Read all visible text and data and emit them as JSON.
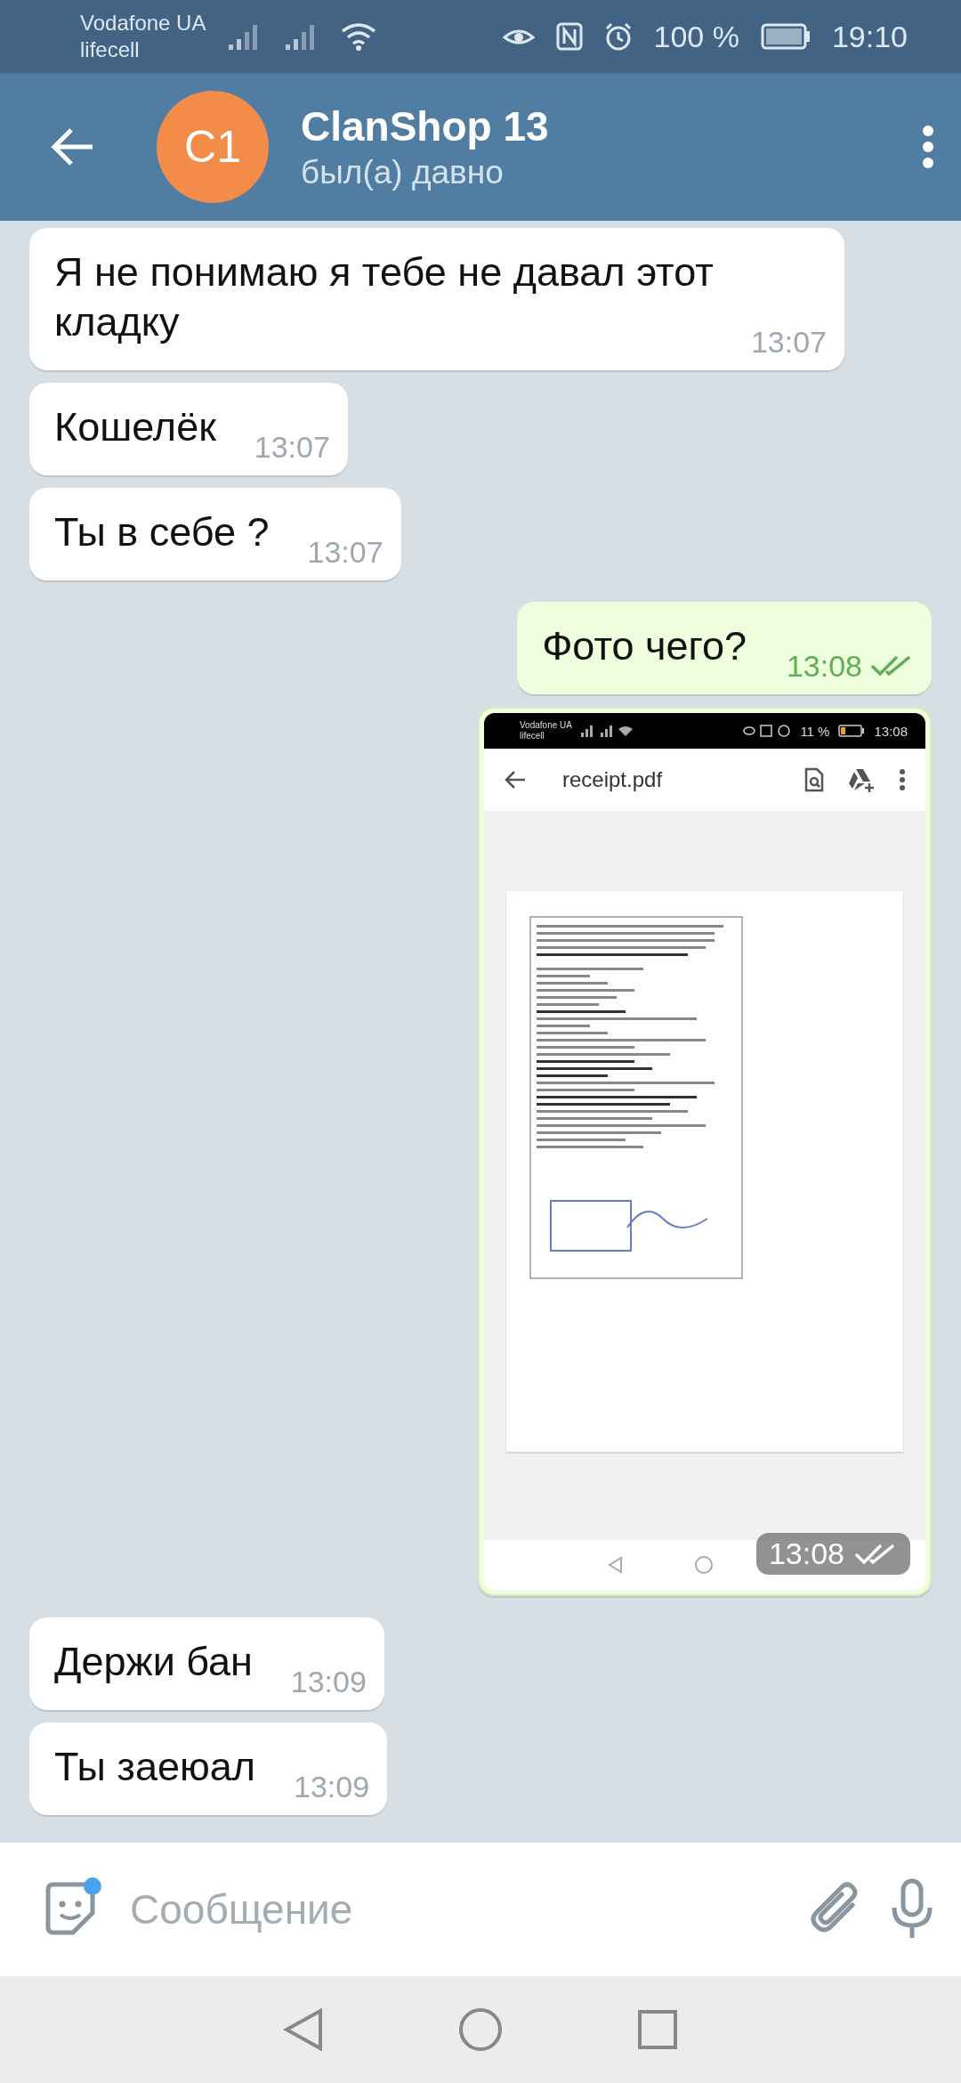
{
  "status_bar": {
    "carrier_1": "Vodafone UA",
    "carrier_2": "lifecell",
    "battery": "100 %",
    "time": "19:10"
  },
  "header": {
    "avatar_initials": "C1",
    "title": "ClanShop 13",
    "subtitle": "был(а) давно"
  },
  "messages": [
    {
      "kind": "text",
      "outgoing": false,
      "text": "Я не понимаю я тебе не давал этот кладку",
      "time": "13:07"
    },
    {
      "kind": "text",
      "outgoing": false,
      "text": "Кошелёк",
      "time": "13:07"
    },
    {
      "kind": "text",
      "outgoing": false,
      "text": "Ты в себе ?",
      "time": "13:07"
    },
    {
      "kind": "text",
      "outgoing": true,
      "text": "Фото чего?",
      "time": "13:08",
      "read": true
    },
    {
      "kind": "photo",
      "outgoing": true,
      "time": "13:08",
      "read": true,
      "screenshot": {
        "carrier_1": "Vodafone UA",
        "carrier_2": "lifecell",
        "battery": "11 %",
        "time": "13:08",
        "file_name": "receipt.pdf"
      }
    },
    {
      "kind": "text",
      "outgoing": false,
      "text": "Держи бан",
      "time": "13:09"
    },
    {
      "kind": "text",
      "outgoing": false,
      "text": "Ты заеюал",
      "time": "13:09"
    }
  ],
  "composer": {
    "placeholder": "Сообщение"
  }
}
